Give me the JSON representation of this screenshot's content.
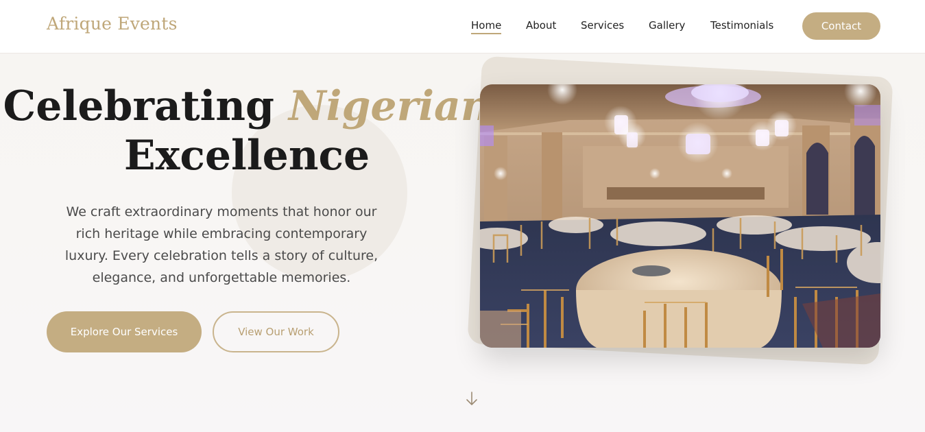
{
  "brand": {
    "name": "Afrique Events",
    "accent_color": "#bfa779"
  },
  "nav": {
    "items": [
      {
        "label": "Home",
        "active": true
      },
      {
        "label": "About",
        "active": false
      },
      {
        "label": "Services",
        "active": false
      },
      {
        "label": "Gallery",
        "active": false
      },
      {
        "label": "Testimonials",
        "active": false
      }
    ],
    "contact_label": "Contact"
  },
  "hero": {
    "headline_part1": "Celebrating",
    "headline_accent": "Nigerian",
    "headline_part2": "Excellence",
    "lead": "We craft extraordinary moments that honor our rich heritage while embracing contemporary luxury. Every celebration tells a story of culture, elegance, and unforgettable memories.",
    "primary_button": "Explore Our Services",
    "secondary_button": "View Our Work",
    "image_subject": "banquet-hall-photo",
    "scroll_icon": "arrow-down-icon"
  }
}
